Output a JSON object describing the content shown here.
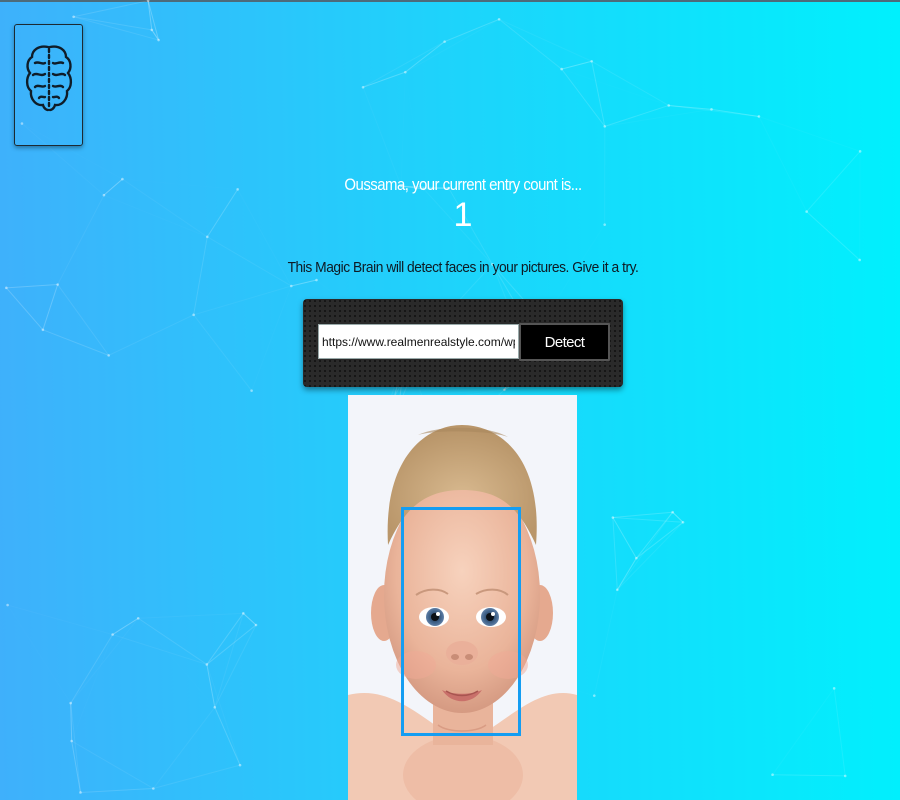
{
  "header": {
    "logo_icon": "brain-icon"
  },
  "rank": {
    "greeting": "Oussama, your current entry count is...",
    "count": "1"
  },
  "intro": {
    "text": "This Magic Brain will detect faces in your pictures. Give it a try."
  },
  "form": {
    "url_value": "https://www.realmenrealstyle.com/wp-content/up",
    "detect_label": "Detect"
  },
  "result": {
    "image_icon": "baby-face-photo",
    "box_color": "#149df2"
  },
  "colors": {
    "gradient_start": "#3fb0fb",
    "gradient_end": "#00f0fd",
    "panel": "#2a2a2a"
  }
}
